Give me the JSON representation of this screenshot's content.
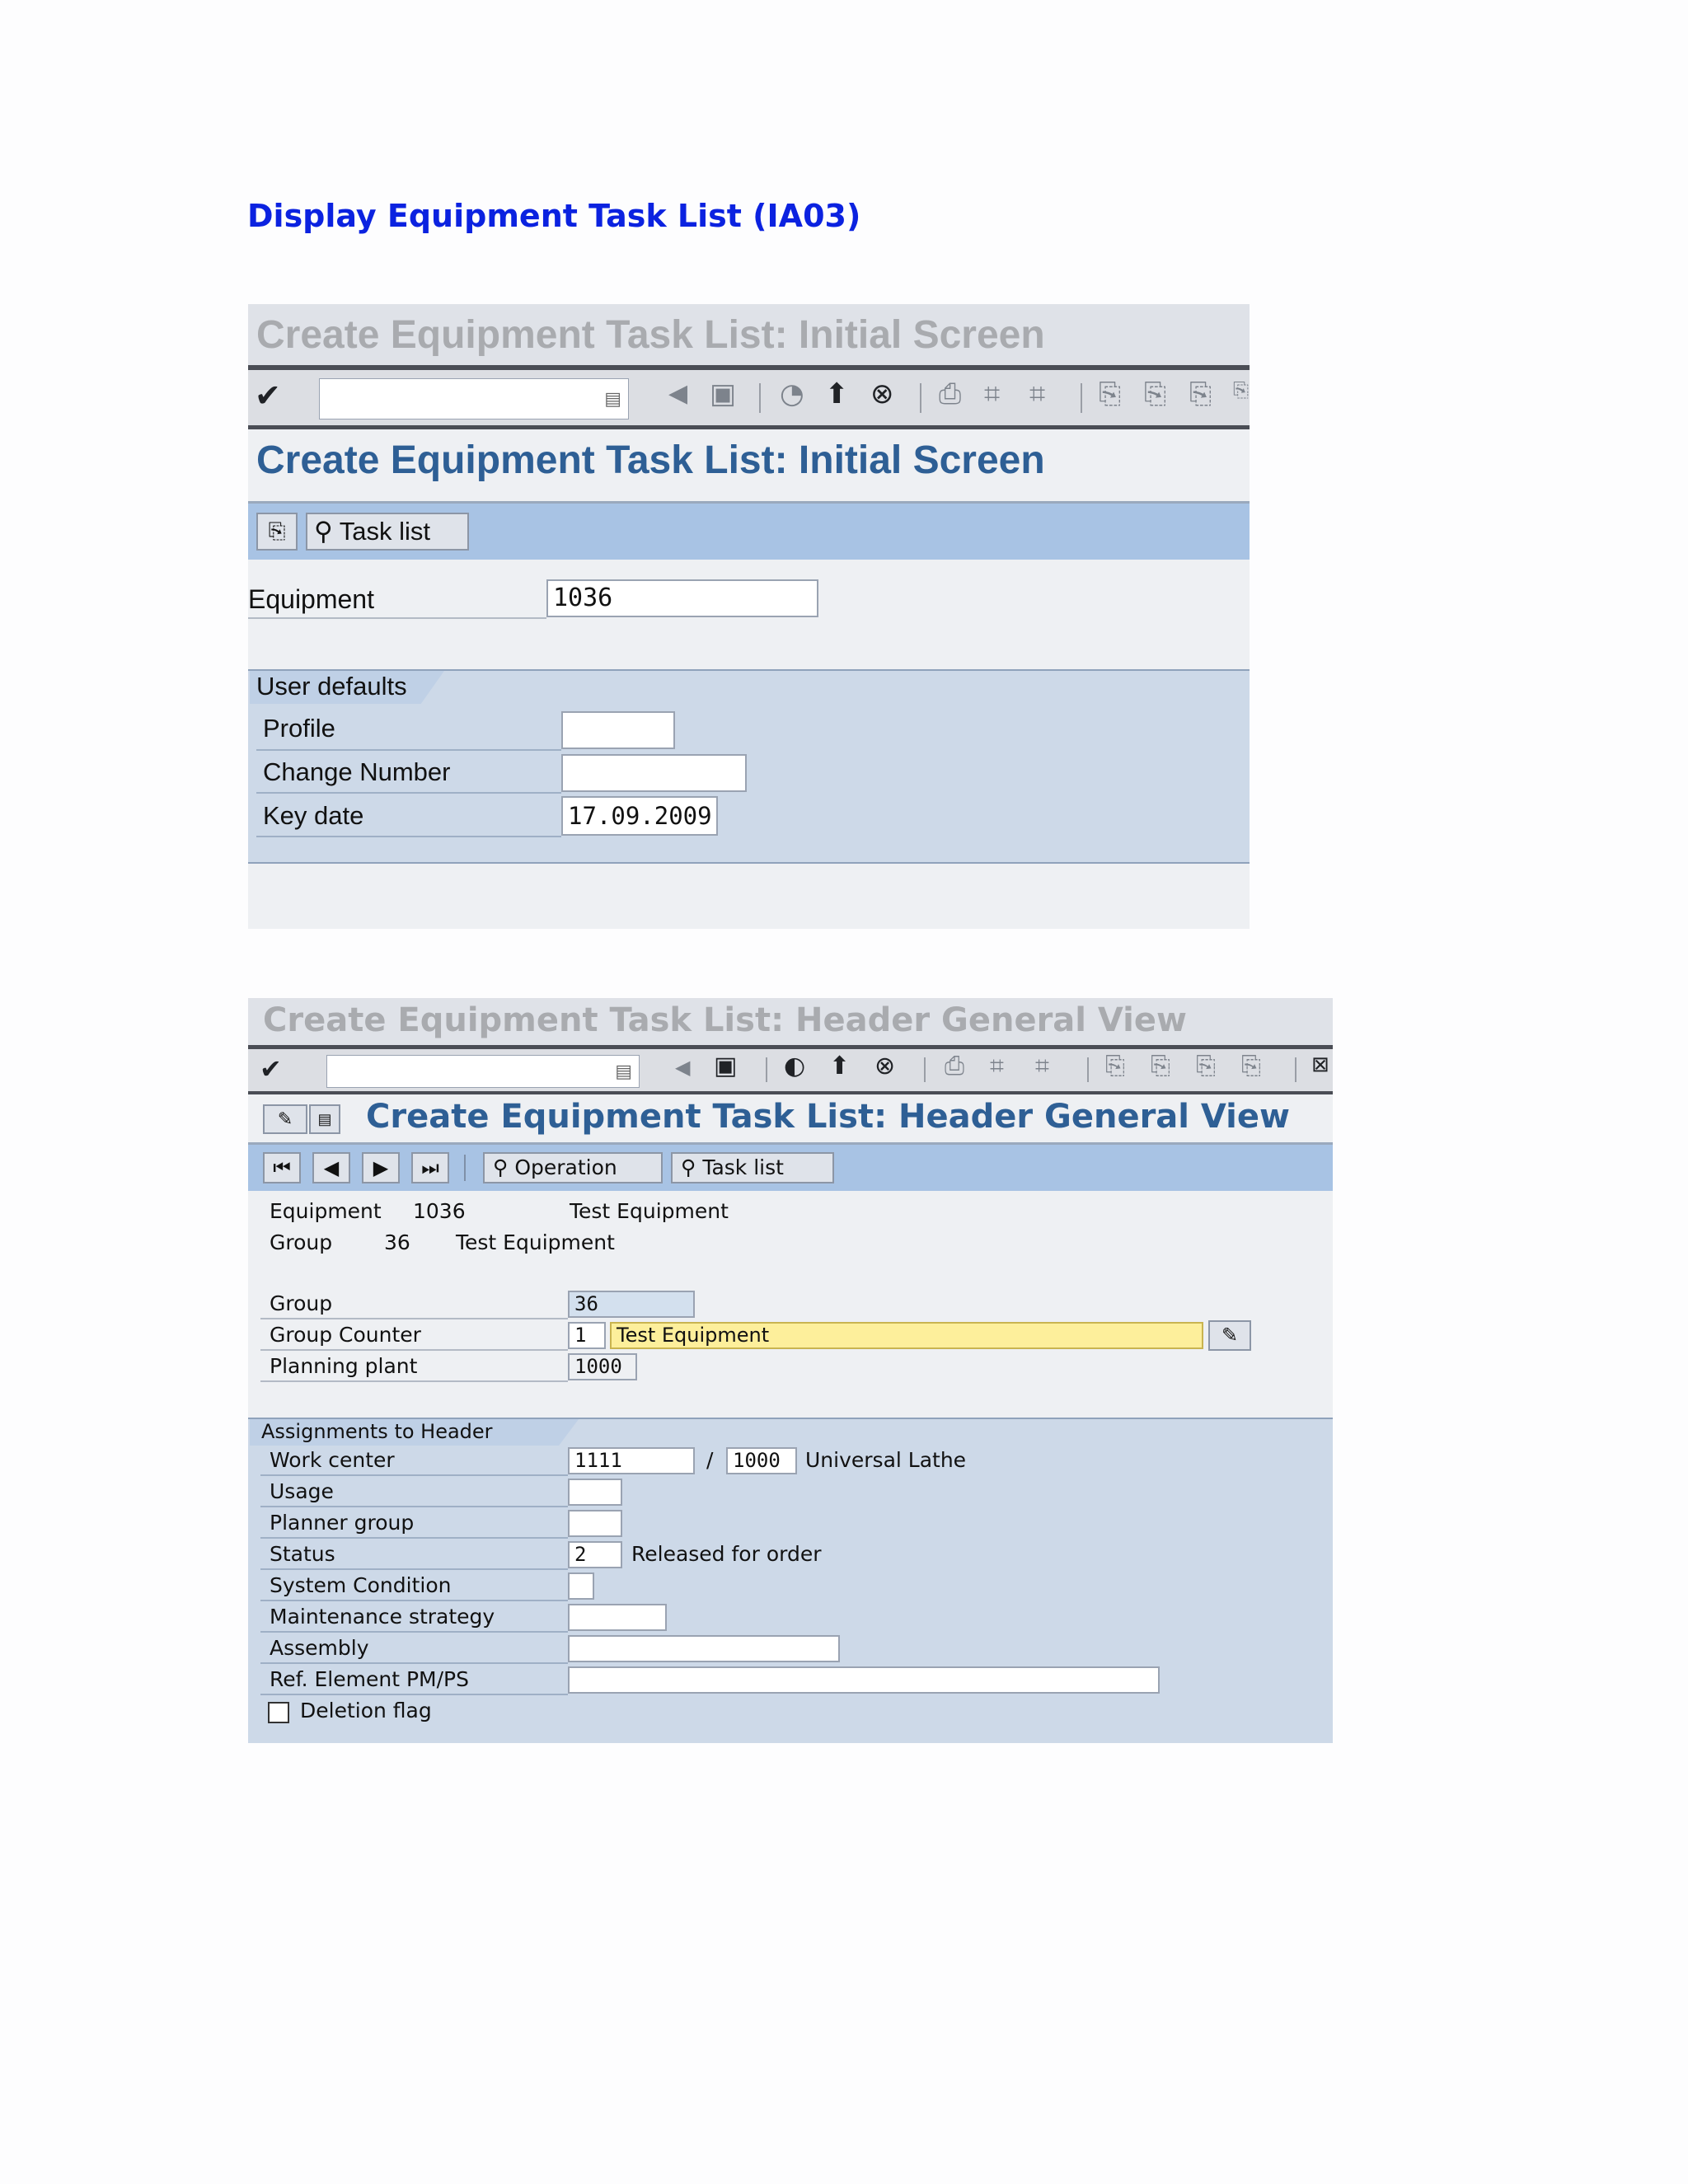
{
  "doc": {
    "heading": "Display Equipment Task List (IA03)"
  },
  "screen1": {
    "window_title": "Create Equipment Task List: Initial Screen",
    "screen_title": "Create Equipment Task List: Initial Screen",
    "toolbar": {
      "icons": [
        "enter-icon",
        "back-icon",
        "save-icon",
        "exit-icon",
        "up-icon",
        "cancel-icon",
        "print-icon",
        "find-icon",
        "find-next-icon",
        "first-page-icon",
        "previous-page-icon",
        "next-page-icon",
        "last-page-icon"
      ]
    },
    "appbar": {
      "copy_icon": "copy-from-icon",
      "task_list_label": "Task list"
    },
    "equipment": {
      "label": "Equipment",
      "value": "1036"
    },
    "user_defaults": {
      "title": "User defaults",
      "profile": {
        "label": "Profile",
        "value": ""
      },
      "change_number": {
        "label": "Change Number",
        "value": ""
      },
      "key_date": {
        "label": "Key date",
        "value": "17.09.2009"
      }
    }
  },
  "screen2": {
    "window_title": "Create Equipment Task List: Header General View",
    "screen_title": "Create Equipment Task List: Header General View",
    "appbar": {
      "operation_label": "Operation",
      "task_list_label": "Task list"
    },
    "info": {
      "equipment_label": "Equipment",
      "equipment_value": "1036",
      "equipment_desc": "Test Equipment",
      "group_label": "Group",
      "group_value": "36",
      "group_desc": "Test Equipment"
    },
    "header": {
      "group": {
        "label": "Group",
        "value": "36"
      },
      "group_counter": {
        "label": "Group Counter",
        "value": "1",
        "description": "Test Equipment"
      },
      "planning_plant": {
        "label": "Planning plant",
        "value": "1000"
      }
    },
    "assignments": {
      "title": "Assignments to Header",
      "work_center": {
        "label": "Work center",
        "value": "1111",
        "separator": "/",
        "plant": "1000",
        "description": "Universal Lathe"
      },
      "usage": {
        "label": "Usage",
        "value": ""
      },
      "planner_group": {
        "label": "Planner group",
        "value": ""
      },
      "status": {
        "label": "Status",
        "value": "2",
        "description": "Released for order"
      },
      "system_condition": {
        "label": "System Condition",
        "value": ""
      },
      "maintenance_strategy": {
        "label": "Maintenance strategy",
        "value": ""
      },
      "assembly": {
        "label": "Assembly",
        "value": ""
      },
      "ref_element": {
        "label": "Ref. Element PM/PS",
        "value": ""
      },
      "deletion_flag": {
        "label": "Deletion flag",
        "checked": false
      }
    }
  },
  "colors": {
    "heading": "#0b22e0",
    "sap_title": "#2e5f95",
    "appbar": "#a8c3e4",
    "group_box": "#cdd9e8",
    "highlight": "#fdef9b"
  }
}
